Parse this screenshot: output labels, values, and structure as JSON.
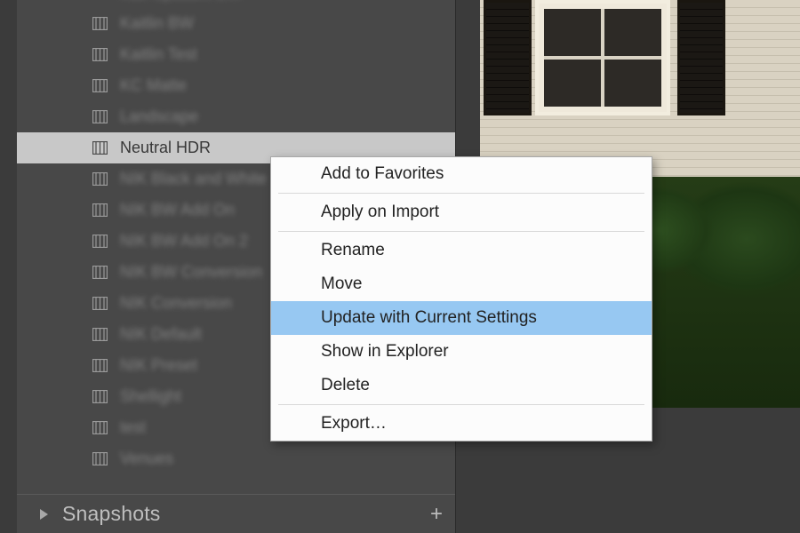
{
  "presets": {
    "items": [
      {
        "label": "Kait Updates BW",
        "selected": false,
        "blurred": true
      },
      {
        "label": "Kaitlin BW",
        "selected": false,
        "blurred": true
      },
      {
        "label": "Kaitlin Test",
        "selected": false,
        "blurred": true
      },
      {
        "label": "KC Matte",
        "selected": false,
        "blurred": true
      },
      {
        "label": "Landscape",
        "selected": false,
        "blurred": true
      },
      {
        "label": "Neutral HDR",
        "selected": true,
        "blurred": false
      },
      {
        "label": "NIK Black and White",
        "selected": false,
        "blurred": true
      },
      {
        "label": "NIK BW Add On",
        "selected": false,
        "blurred": true
      },
      {
        "label": "NIK BW Add On 2",
        "selected": false,
        "blurred": true
      },
      {
        "label": "NIK BW Conversion",
        "selected": false,
        "blurred": true
      },
      {
        "label": "NIK Conversion",
        "selected": false,
        "blurred": true
      },
      {
        "label": "NIK Default",
        "selected": false,
        "blurred": true
      },
      {
        "label": "NIK Preset",
        "selected": false,
        "blurred": true
      },
      {
        "label": "Shellight",
        "selected": false,
        "blurred": true
      },
      {
        "label": "test",
        "selected": false,
        "blurred": true
      },
      {
        "label": "Venues",
        "selected": false,
        "blurred": true
      }
    ]
  },
  "panel": {
    "snapshots_title": "Snapshots"
  },
  "contextMenu": {
    "items": [
      {
        "label": "Add to Favorites",
        "highlighted": false
      },
      {
        "sep": true
      },
      {
        "label": "Apply on Import",
        "highlighted": false
      },
      {
        "sep": true
      },
      {
        "label": "Rename",
        "highlighted": false
      },
      {
        "label": "Move",
        "highlighted": false
      },
      {
        "label": "Update with Current Settings",
        "highlighted": true
      },
      {
        "label": "Show in Explorer",
        "highlighted": false
      },
      {
        "label": "Delete",
        "highlighted": false
      },
      {
        "sep": true
      },
      {
        "label": "Export…",
        "highlighted": false
      }
    ]
  }
}
